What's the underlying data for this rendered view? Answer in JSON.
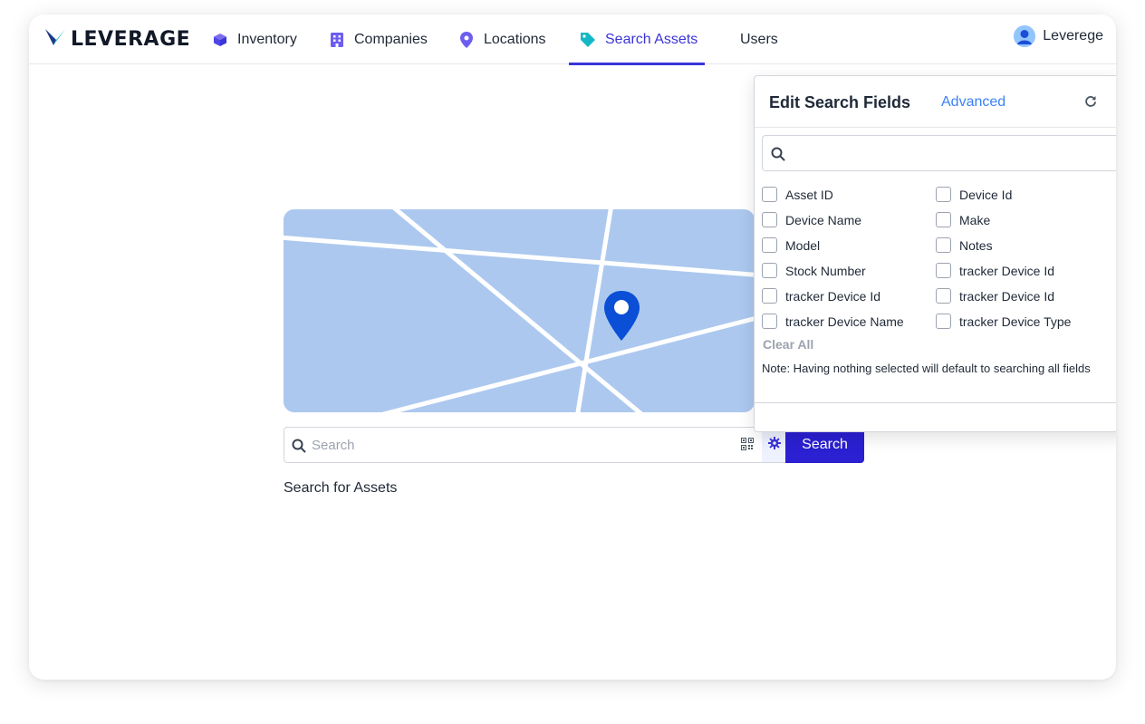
{
  "app": {
    "logo_text": "LEVERAGE"
  },
  "nav": {
    "items": [
      {
        "label": "Inventory",
        "icon": "cube-icon"
      },
      {
        "label": "Companies",
        "icon": "building-icon"
      },
      {
        "label": "Locations",
        "icon": "map-pin-icon"
      },
      {
        "label": "Search Assets",
        "icon": "tag-icon",
        "active": true
      },
      {
        "label": "Users",
        "icon": ""
      }
    ],
    "user_name": "Leverege"
  },
  "colors": {
    "accent": "#2b20d2",
    "map_bg": "#acc8ef",
    "pin": "#0a4fd6",
    "link": "#3b82f6"
  },
  "search": {
    "placeholder": "Search",
    "button_label": "Search",
    "caption": "Search for Assets"
  },
  "panel": {
    "title": "Edit Search Fields",
    "advanced_label": "Advanced",
    "search_placeholder": "",
    "options": [
      {
        "label": "Asset ID",
        "checked": false
      },
      {
        "label": "Device Id",
        "checked": false
      },
      {
        "label": "Device Name",
        "checked": false
      },
      {
        "label": "Make",
        "checked": false
      },
      {
        "label": "Model",
        "checked": false
      },
      {
        "label": "Notes",
        "checked": false
      },
      {
        "label": "Stock Number",
        "checked": false
      },
      {
        "label": "tracker Device Id",
        "checked": false
      },
      {
        "label": "tracker Device Id",
        "checked": false
      },
      {
        "label": "tracker Device Id",
        "checked": false
      },
      {
        "label": "tracker Device Name",
        "checked": false
      },
      {
        "label": "tracker Device Type",
        "checked": false
      }
    ],
    "clear_all_label": "Clear All",
    "note": "Note: Having nothing selected will default to searching all fields"
  }
}
